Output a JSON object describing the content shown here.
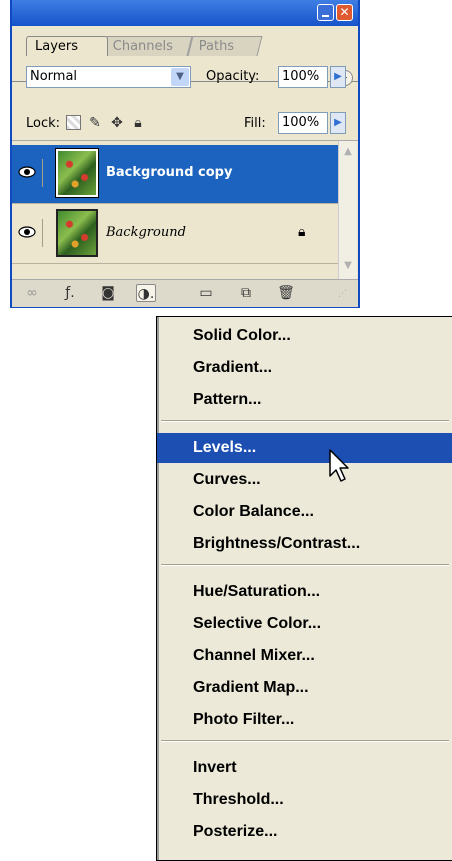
{
  "panel": {
    "tabs": [
      "Layers",
      "Channels",
      "Paths"
    ],
    "panel_menu_icon": "triangle-right-icon",
    "blend_mode": "Normal",
    "opacity_label": "Opacity:",
    "opacity_value": "100%",
    "lock_label": "Lock:",
    "fill_label": "Fill:",
    "fill_value": "100%",
    "layers": [
      {
        "name": "Background copy",
        "selected": true,
        "visible": true
      },
      {
        "name": "Background",
        "selected": false,
        "visible": true,
        "locked": true
      }
    ],
    "toolbar_icons": [
      "link-icon",
      "layer-style-icon",
      "layer-mask-icon",
      "adjustment-layer-icon",
      "group-folder-icon",
      "new-layer-icon",
      "trash-icon"
    ]
  },
  "menu": {
    "groups": [
      [
        "Solid Color...",
        "Gradient...",
        "Pattern..."
      ],
      [
        "Levels...",
        "Curves...",
        "Color Balance...",
        "Brightness/Contrast..."
      ],
      [
        "Hue/Saturation...",
        "Selective Color...",
        "Channel Mixer...",
        "Gradient Map...",
        "Photo Filter..."
      ],
      [
        "Invert",
        "Threshold...",
        "Posterize..."
      ]
    ],
    "highlighted": "Levels..."
  },
  "colors": {
    "title_bar": "#1654cb",
    "selection": "#1c4fb1",
    "panel_bg": "#ece6cf",
    "menu_bg": "#ece9d8"
  }
}
